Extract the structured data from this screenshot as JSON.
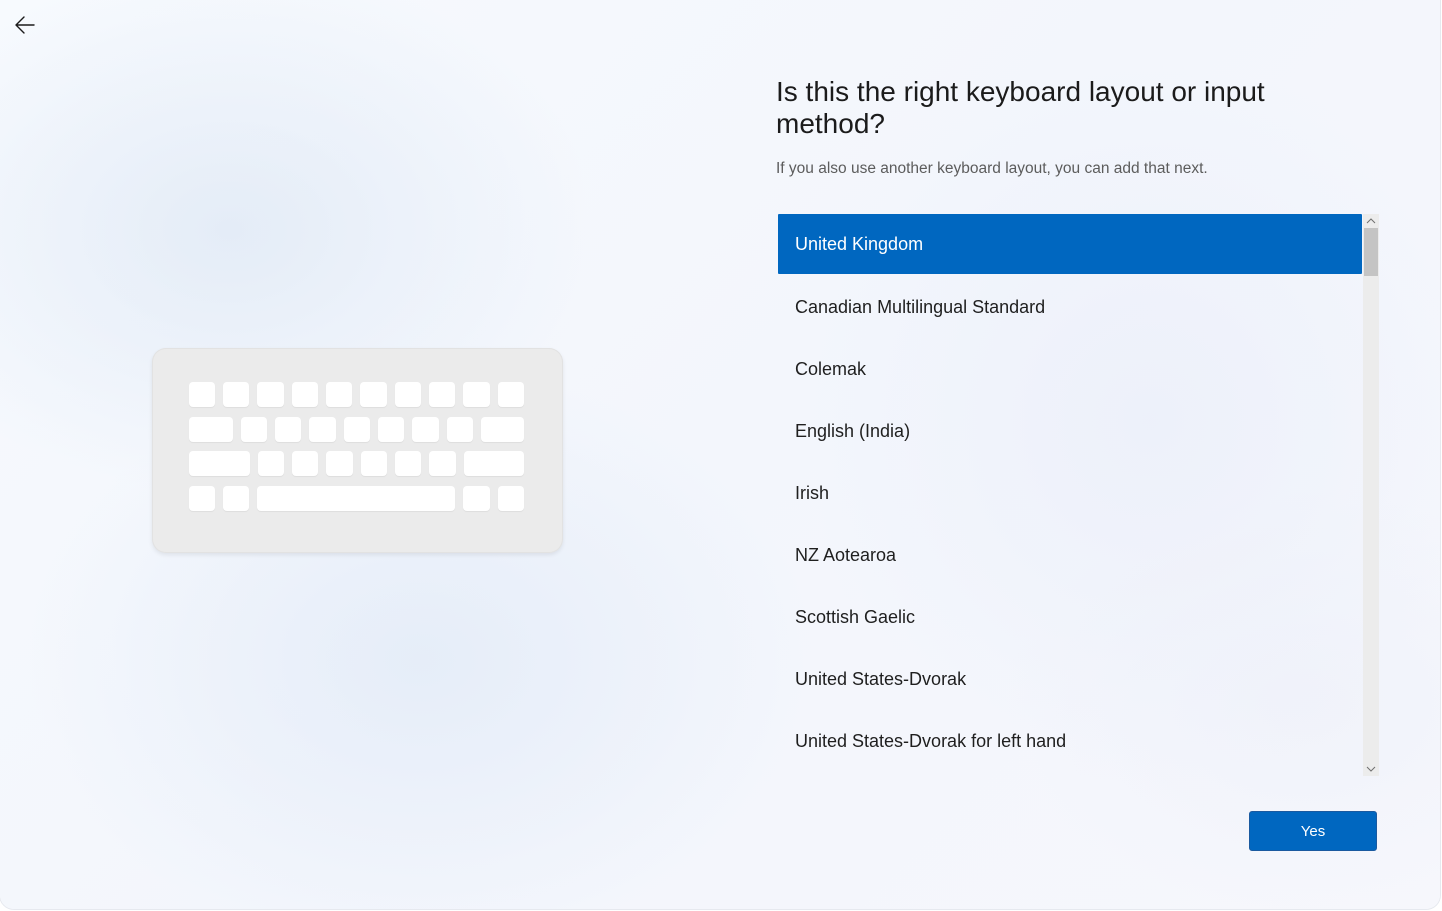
{
  "header": {
    "back_icon": "arrow-left-icon",
    "title": "Is this the right keyboard layout or input method?",
    "subtitle": "If you also use another keyboard layout, you can add that next."
  },
  "illustration": {
    "icon": "keyboard-illustration"
  },
  "layout_list": {
    "selected_index": 0,
    "items": [
      {
        "label": "United Kingdom"
      },
      {
        "label": "Canadian Multilingual Standard"
      },
      {
        "label": "Colemak"
      },
      {
        "label": "English (India)"
      },
      {
        "label": "Irish"
      },
      {
        "label": "NZ Aotearoa"
      },
      {
        "label": "Scottish Gaelic"
      },
      {
        "label": "United States-Dvorak"
      },
      {
        "label": "United States-Dvorak for left hand"
      }
    ]
  },
  "scrollbar": {
    "up_icon": "chevron-up-icon",
    "down_icon": "chevron-down-icon"
  },
  "footer": {
    "yes_label": "Yes"
  },
  "colors": {
    "accent": "#0067c0",
    "selected_text": "#ffffff",
    "scroll_track": "#ececec",
    "scroll_thumb": "#c4c4c4"
  }
}
